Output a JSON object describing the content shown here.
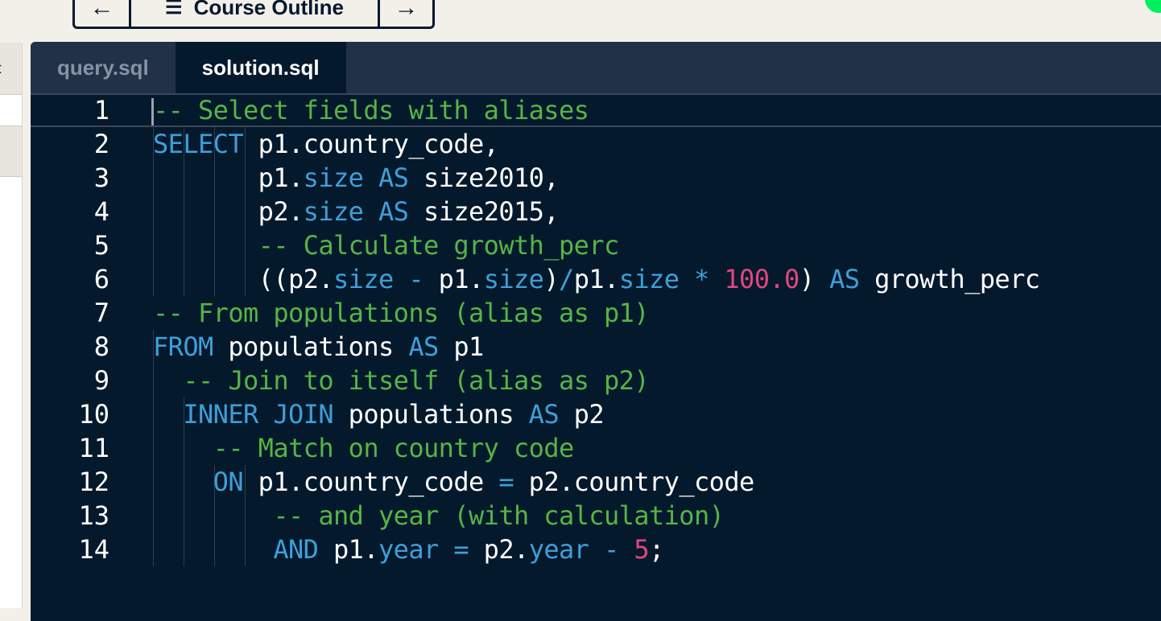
{
  "nav": {
    "prev_icon": "arrow-left-icon",
    "outline_icon": "hamburger-icon",
    "outline_label": "Course Outline",
    "next_icon": "arrow-right-icon"
  },
  "editor": {
    "tabs": [
      {
        "label": "query.sql",
        "active": false
      },
      {
        "label": "solution.sql",
        "active": true
      }
    ],
    "lines": [
      {
        "no": "1",
        "tokens": [
          {
            "t": "-- Select fields with aliases",
            "c": "c"
          }
        ]
      },
      {
        "no": "2",
        "tokens": [
          {
            "t": "SELECT",
            "c": "k"
          },
          {
            "t": " p1.country_code,",
            "c": "p"
          }
        ]
      },
      {
        "no": "3",
        "tokens": [
          {
            "t": "       p1.",
            "c": "p"
          },
          {
            "t": "size",
            "c": "k"
          },
          {
            "t": " ",
            "c": "p"
          },
          {
            "t": "AS",
            "c": "k"
          },
          {
            "t": " size2010,",
            "c": "p"
          }
        ]
      },
      {
        "no": "4",
        "tokens": [
          {
            "t": "       p2.",
            "c": "p"
          },
          {
            "t": "size",
            "c": "k"
          },
          {
            "t": " ",
            "c": "p"
          },
          {
            "t": "AS",
            "c": "k"
          },
          {
            "t": " size2015,",
            "c": "p"
          }
        ]
      },
      {
        "no": "5",
        "tokens": [
          {
            "t": "       ",
            "c": "p"
          },
          {
            "t": "-- Calculate growth_perc",
            "c": "c"
          }
        ]
      },
      {
        "no": "6",
        "tokens": [
          {
            "t": "       ((p2.",
            "c": "p"
          },
          {
            "t": "size",
            "c": "k"
          },
          {
            "t": " ",
            "c": "p"
          },
          {
            "t": "-",
            "c": "k"
          },
          {
            "t": " p1.",
            "c": "p"
          },
          {
            "t": "size",
            "c": "k"
          },
          {
            "t": ")",
            "c": "p"
          },
          {
            "t": "/",
            "c": "k"
          },
          {
            "t": "p1.",
            "c": "p"
          },
          {
            "t": "size",
            "c": "k"
          },
          {
            "t": " ",
            "c": "p"
          },
          {
            "t": "*",
            "c": "k"
          },
          {
            "t": " ",
            "c": "p"
          },
          {
            "t": "100.0",
            "c": "n"
          },
          {
            "t": ") ",
            "c": "p"
          },
          {
            "t": "AS",
            "c": "k"
          },
          {
            "t": " growth_perc",
            "c": "p"
          }
        ]
      },
      {
        "no": "7",
        "tokens": [
          {
            "t": "-- From populations (alias as p1)",
            "c": "c"
          }
        ]
      },
      {
        "no": "8",
        "tokens": [
          {
            "t": "FROM",
            "c": "k"
          },
          {
            "t": " populations ",
            "c": "p"
          },
          {
            "t": "AS",
            "c": "k"
          },
          {
            "t": " p1",
            "c": "p"
          }
        ]
      },
      {
        "no": "9",
        "tokens": [
          {
            "t": "  ",
            "c": "p"
          },
          {
            "t": "-- Join to itself (alias as p2)",
            "c": "c"
          }
        ]
      },
      {
        "no": "10",
        "tokens": [
          {
            "t": "  ",
            "c": "p"
          },
          {
            "t": "INNER JOIN",
            "c": "k"
          },
          {
            "t": " populations ",
            "c": "p"
          },
          {
            "t": "AS",
            "c": "k"
          },
          {
            "t": " p2",
            "c": "p"
          }
        ]
      },
      {
        "no": "11",
        "tokens": [
          {
            "t": "    ",
            "c": "p"
          },
          {
            "t": "-- Match on country code",
            "c": "c"
          }
        ]
      },
      {
        "no": "12",
        "tokens": [
          {
            "t": "    ",
            "c": "p"
          },
          {
            "t": "ON",
            "c": "k"
          },
          {
            "t": " p1.country_code ",
            "c": "p"
          },
          {
            "t": "=",
            "c": "k"
          },
          {
            "t": " p2.country_code",
            "c": "p"
          }
        ]
      },
      {
        "no": "13",
        "tokens": [
          {
            "t": "        ",
            "c": "p"
          },
          {
            "t": "-- and year (with calculation)",
            "c": "c"
          }
        ]
      },
      {
        "no": "14",
        "tokens": [
          {
            "t": "        ",
            "c": "p"
          },
          {
            "t": "AND",
            "c": "k"
          },
          {
            "t": " p1.",
            "c": "p"
          },
          {
            "t": "year",
            "c": "k"
          },
          {
            "t": " ",
            "c": "p"
          },
          {
            "t": "=",
            "c": "k"
          },
          {
            "t": " p2.",
            "c": "p"
          },
          {
            "t": "year",
            "c": "k"
          },
          {
            "t": " ",
            "c": "p"
          },
          {
            "t": "-",
            "c": "k"
          },
          {
            "t": " ",
            "c": "p"
          },
          {
            "t": "5",
            "c": "n"
          },
          {
            "t": ";",
            "c": "p"
          }
        ]
      }
    ]
  }
}
